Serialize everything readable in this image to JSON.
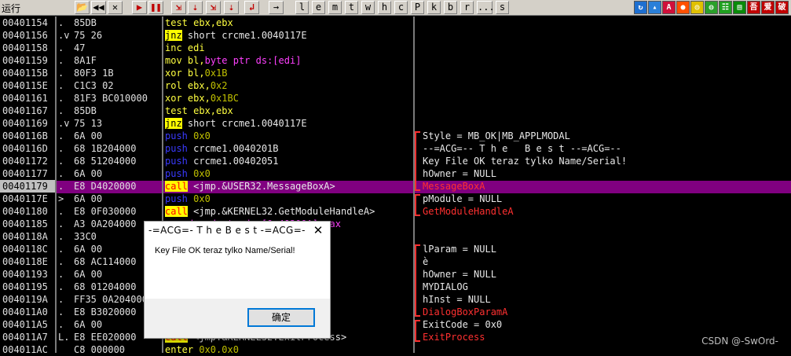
{
  "toolbar": {
    "title": "运行",
    "buttons": [
      {
        "name": "open-icon",
        "label": "📂"
      },
      {
        "name": "restart-icon",
        "label": "◀◀"
      },
      {
        "name": "close-icon",
        "label": "✕"
      },
      {
        "name": "run-icon",
        "label": "▶"
      },
      {
        "name": "pause-icon",
        "label": "❚❚"
      },
      {
        "name": "step-into-icon",
        "label": "⇲"
      },
      {
        "name": "step-over-icon",
        "label": "⇣"
      },
      {
        "name": "trace-into-icon",
        "label": "⇲"
      },
      {
        "name": "trace-over-icon",
        "label": "⇣"
      },
      {
        "name": "execute-till-return-icon",
        "label": "↲"
      },
      {
        "name": "goto-icon",
        "label": "→"
      }
    ],
    "letters": [
      "l",
      "e",
      "m",
      "t",
      "w",
      "h",
      "c",
      "P",
      "k",
      "b",
      "r",
      "...",
      "s"
    ],
    "right_icons": [
      {
        "name": "refresh-icon",
        "label": "↻",
        "color": "#1e6fd0"
      },
      {
        "name": "mark-icon",
        "label": "▴",
        "color": "#2a7fd8"
      },
      {
        "name": "a-icon",
        "label": "A",
        "color": "#d0103a"
      },
      {
        "name": "record-icon",
        "label": "●",
        "color": "#ff5000"
      },
      {
        "name": "target-icon",
        "label": "◎",
        "color": "#e0c000"
      },
      {
        "name": "plugin-icon",
        "label": "◍",
        "color": "#2aa02a"
      },
      {
        "name": "list-icon",
        "label": "☷",
        "color": "#20a020"
      },
      {
        "name": "book-icon",
        "label": "▤",
        "color": "#0a8a0a"
      },
      {
        "name": "lang-1-icon",
        "label": "吾",
        "color": "#c00000"
      },
      {
        "name": "lang-2-icon",
        "label": "爱",
        "color": "#c00000"
      },
      {
        "name": "lang-3-icon",
        "label": "破",
        "color": "#c00000"
      }
    ]
  },
  "rows": [
    {
      "addr": "00401154",
      "mark": ".",
      "hex": "85DB",
      "parts": [
        {
          "t": "test",
          "c": "mn-test"
        },
        {
          "t": " ebx,ebx",
          "c": "mn-yellow"
        }
      ],
      "comment": ""
    },
    {
      "addr": "00401156",
      "mark": ".v",
      "hex": "75 26",
      "parts": [
        {
          "t": "jnz",
          "c": "mn-jnz"
        },
        {
          "t": " short crcme1.0040117E",
          "c": ""
        }
      ],
      "comment": ""
    },
    {
      "addr": "00401158",
      "mark": ".",
      "hex": "47",
      "parts": [
        {
          "t": "inc",
          "c": "mn-yellow"
        },
        {
          "t": " edi",
          "c": "mn-yellow"
        }
      ],
      "comment": ""
    },
    {
      "addr": "00401159",
      "mark": ".",
      "hex": "8A1F",
      "parts": [
        {
          "t": "mov",
          "c": "mn-yellow"
        },
        {
          "t": " bl,",
          "c": "mn-yellow"
        },
        {
          "t": "byte ptr ds:[edi]",
          "c": "imm"
        }
      ],
      "comment": ""
    },
    {
      "addr": "0040115B",
      "mark": ".",
      "hex": "80F3 1B",
      "parts": [
        {
          "t": "xor",
          "c": "mn-yellow"
        },
        {
          "t": " bl,",
          "c": "mn-yellow"
        },
        {
          "t": "0x1B",
          "c": "dim"
        }
      ],
      "comment": ""
    },
    {
      "addr": "0040115E",
      "mark": ".",
      "hex": "C1C3 02",
      "parts": [
        {
          "t": "rol",
          "c": "mn-yellow"
        },
        {
          "t": " ebx,",
          "c": "mn-yellow"
        },
        {
          "t": "0x2",
          "c": "dim"
        }
      ],
      "comment": ""
    },
    {
      "addr": "00401161",
      "mark": ".",
      "hex": "81F3 BC010000",
      "parts": [
        {
          "t": "xor",
          "c": "mn-yellow"
        },
        {
          "t": " ebx,",
          "c": "mn-yellow"
        },
        {
          "t": "0x1BC",
          "c": "dim"
        }
      ],
      "comment": ""
    },
    {
      "addr": "00401167",
      "mark": ".",
      "hex": "85DB",
      "parts": [
        {
          "t": "test",
          "c": "mn-test"
        },
        {
          "t": " ebx,ebx",
          "c": "mn-yellow"
        }
      ],
      "comment": ""
    },
    {
      "addr": "00401169",
      "mark": ".v",
      "hex": "75 13",
      "parts": [
        {
          "t": "jnz",
          "c": "mn-jnz"
        },
        {
          "t": " short crcme1.0040117E",
          "c": ""
        }
      ],
      "comment": ""
    },
    {
      "addr": "0040116B",
      "mark": ".",
      "hex": "6A 00",
      "parts": [
        {
          "t": "push",
          "c": "mn-push"
        },
        {
          "t": " 0x0",
          "c": "dim"
        }
      ],
      "comment": "Style = MB_OK|MB_APPLMODAL",
      "cc": "",
      "br": "top"
    },
    {
      "addr": "0040116D",
      "mark": ".",
      "hex": "68 1B204000",
      "parts": [
        {
          "t": "push",
          "c": "mn-push"
        },
        {
          "t": " crcme1.0040201B",
          "c": ""
        }
      ],
      "comment": "--=ACG=-- T h e   B e s t --=ACG=--",
      "cc": ""
    },
    {
      "addr": "00401172",
      "mark": ".",
      "hex": "68 51204000",
      "parts": [
        {
          "t": "push",
          "c": "mn-push"
        },
        {
          "t": " crcme1.00402051",
          "c": ""
        }
      ],
      "comment": "Key File OK teraz tylko Name/Serial!",
      "cc": ""
    },
    {
      "addr": "00401177",
      "mark": ".",
      "hex": "6A 00",
      "parts": [
        {
          "t": "push",
          "c": "mn-push"
        },
        {
          "t": " 0x0",
          "c": "dim"
        }
      ],
      "comment": "hOwner = NULL",
      "cc": ""
    },
    {
      "addr": "00401179",
      "mark": ".",
      "hex": "E8 D4020000",
      "parts": [
        {
          "t": "call",
          "c": "mn-call"
        },
        {
          "t": " <jmp.&USER32.MessageBoxA>",
          "c": ""
        }
      ],
      "comment": "MessageBoxA",
      "cc": "api",
      "br": "bottom",
      "cur": true
    },
    {
      "addr": "0040117E",
      "mark": ">",
      "hex": "6A 00",
      "parts": [
        {
          "t": "push",
          "c": "mn-push"
        },
        {
          "t": " 0x0",
          "c": "dim"
        }
      ],
      "comment": "pModule = NULL",
      "cc": "",
      "br": "top"
    },
    {
      "addr": "00401180",
      "mark": ".",
      "hex": "E8 0F030000",
      "parts": [
        {
          "t": "call",
          "c": "mn-call"
        },
        {
          "t": " <jmp.&KERNEL32.GetModuleHandleA>",
          "c": ""
        }
      ],
      "comment": "GetModuleHandleA",
      "cc": "api",
      "br": "bottom"
    },
    {
      "addr": "00401185",
      "mark": ".",
      "hex": "A3 0A204000",
      "parts": [
        {
          "t": "mov",
          "c": "mn-yellow"
        },
        {
          "t": " dword ptr ds:[0x40200A],eax",
          "c": "imm"
        }
      ],
      "comment": ""
    },
    {
      "addr": "0040118A",
      "mark": ".",
      "hex": "33C0",
      "parts": [
        {
          "t": "",
          "c": ""
        }
      ],
      "comment": ""
    },
    {
      "addr": "0040118C",
      "mark": ".",
      "hex": "6A 00",
      "parts": [
        {
          "t": "",
          "c": ""
        }
      ],
      "comment": "lParam = NULL",
      "cc": "",
      "br": "top"
    },
    {
      "addr": "0040118E",
      "mark": ".",
      "hex": "68 AC114000",
      "parts": [
        {
          "t": "",
          "c": ""
        }
      ],
      "comment": "è",
      "cc": ""
    },
    {
      "addr": "00401193",
      "mark": ".",
      "hex": "6A 00",
      "parts": [
        {
          "t": "",
          "c": ""
        }
      ],
      "comment": "hOwner = NULL",
      "cc": ""
    },
    {
      "addr": "00401195",
      "mark": ".",
      "hex": "68 01204000",
      "parts": [
        {
          "t": "",
          "c": ""
        }
      ],
      "comment": "MYDIALOG",
      "cc": ""
    },
    {
      "addr": "0040119A",
      "mark": ".",
      "hex": "FF35 0A204000",
      "parts": [
        {
          "t": "",
          "c": ""
        },
        {
          "t": "                  A]",
          "c": "imm"
        }
      ],
      "comment": "hInst = NULL",
      "cc": ""
    },
    {
      "addr": "004011A0",
      "mark": ".",
      "hex": "E8 B3020000",
      "parts": [
        {
          "t": "",
          "c": ""
        },
        {
          "t": "                  xParamA>",
          "c": ""
        }
      ],
      "comment": "DialogBoxParamA",
      "cc": "api",
      "br": "bottom"
    },
    {
      "addr": "004011A5",
      "mark": ".",
      "hex": "6A 00",
      "parts": [
        {
          "t": "",
          "c": ""
        }
      ],
      "comment": "ExitCode = 0x0",
      "cc": "",
      "br": "top"
    },
    {
      "addr": "004011A7",
      "mark": "L.",
      "hex": "E8 EE020000",
      "parts": [
        {
          "t": "call",
          "c": "mn-call"
        },
        {
          "t": " <jmp.&KERNEL32.ExitProcess>",
          "c": ""
        }
      ],
      "comment": "ExitProcess",
      "cc": "api",
      "br": "bottom"
    },
    {
      "addr": "004011AC",
      "mark": "",
      "hex": "C8 000000",
      "parts": [
        {
          "t": "enter",
          "c": "mn-yellow"
        },
        {
          "t": " 0x0,0x0",
          "c": "dim"
        }
      ],
      "comment": ""
    }
  ],
  "dialog": {
    "title": "-=ACG=- T h e   B e s t -=ACG=-",
    "close_label": "✕",
    "message": "Key File OK teraz tylko Name/Serial!",
    "ok_label": "确定"
  },
  "watermark": "CSDN @-SwOrd-"
}
